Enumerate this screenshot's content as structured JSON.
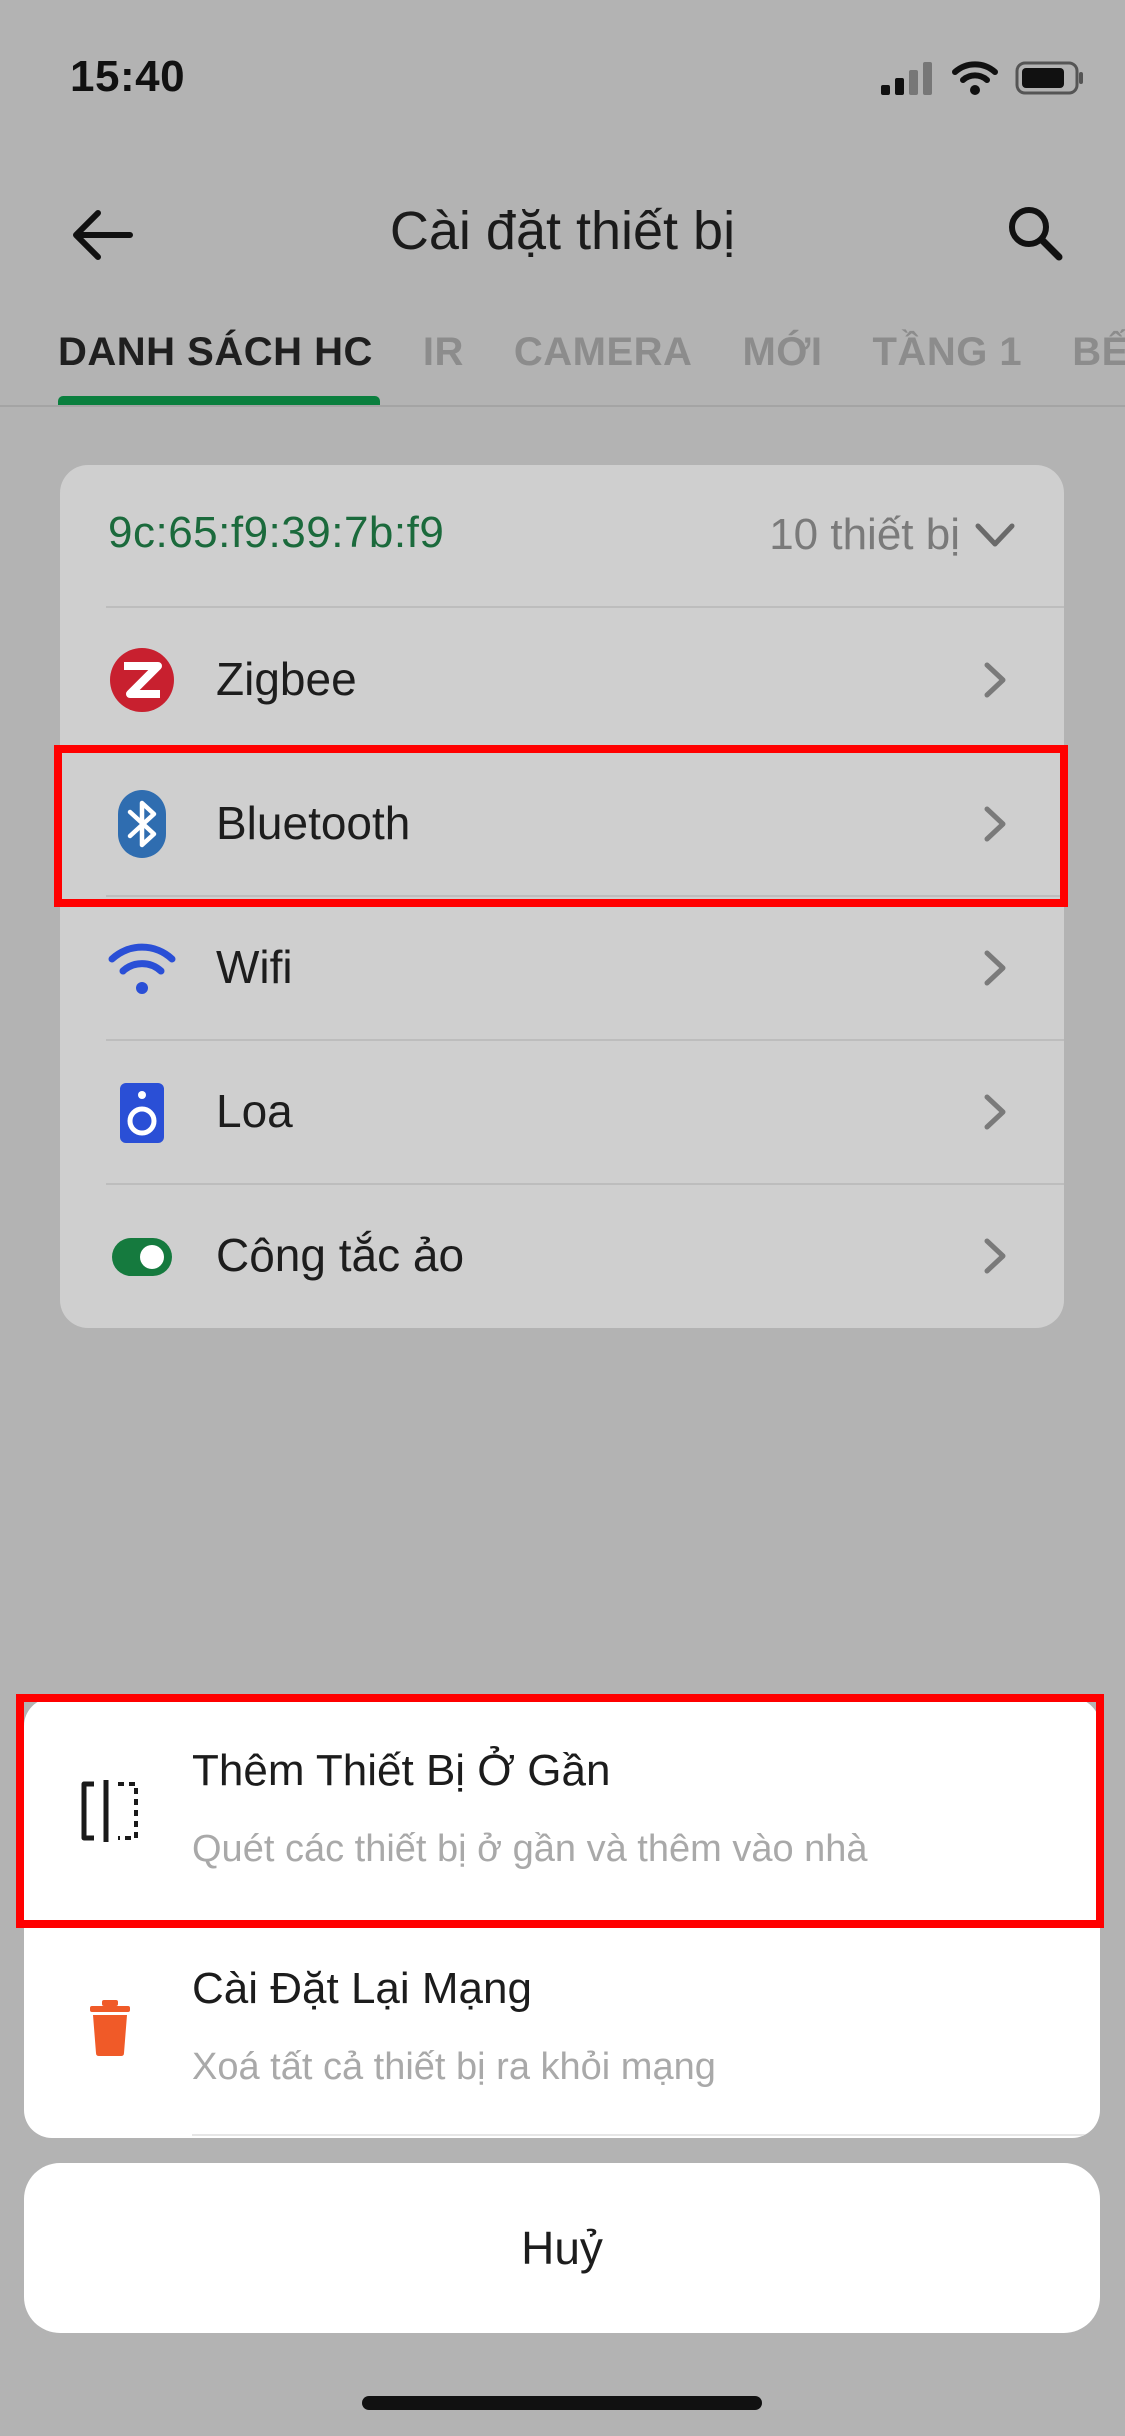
{
  "status_bar": {
    "time": "15:40"
  },
  "header": {
    "title": "Cài đặt thiết bị",
    "back_icon": "arrow-left-icon",
    "search_icon": "search-icon"
  },
  "tabs": [
    {
      "label": "DANH SÁCH HC",
      "active": true
    },
    {
      "label": "IR"
    },
    {
      "label": "CAMERA"
    },
    {
      "label": "MỚI"
    },
    {
      "label": "TẦNG 1"
    },
    {
      "label": "BẾ"
    }
  ],
  "hc_card": {
    "id": "9c:65:f9:39:7b:f9",
    "device_count": "10 thiết bị",
    "items": [
      {
        "label": "Zigbee",
        "icon": "zigbee-icon",
        "color": "#c8202f"
      },
      {
        "label": "Bluetooth",
        "icon": "bluetooth-icon",
        "color": "#2f6db0"
      },
      {
        "label": "Wifi",
        "icon": "wifi-icon",
        "color": "#2a4fd6"
      },
      {
        "label": "Loa",
        "icon": "speaker-icon",
        "color": "#2a4fd6"
      },
      {
        "label": "Công tắc ảo",
        "icon": "toggle-icon",
        "color": "#157a3e"
      }
    ]
  },
  "action_sheet": {
    "items": [
      {
        "title": "Thêm Thiết Bị Ở Gần",
        "subtitle": "Quét các thiết bị ở gần và thêm vào nhà",
        "icon": "scan-nearby-icon"
      },
      {
        "title": "Cài Đặt Lại Mạng",
        "subtitle": "Xoá tất cả thiết bị ra khỏi mạng",
        "icon": "trash-icon",
        "color": "#f05a28"
      }
    ],
    "cancel_label": "Huỷ"
  },
  "colors": {
    "accent": "#0a7f3e",
    "highlight": "#ff0000"
  }
}
